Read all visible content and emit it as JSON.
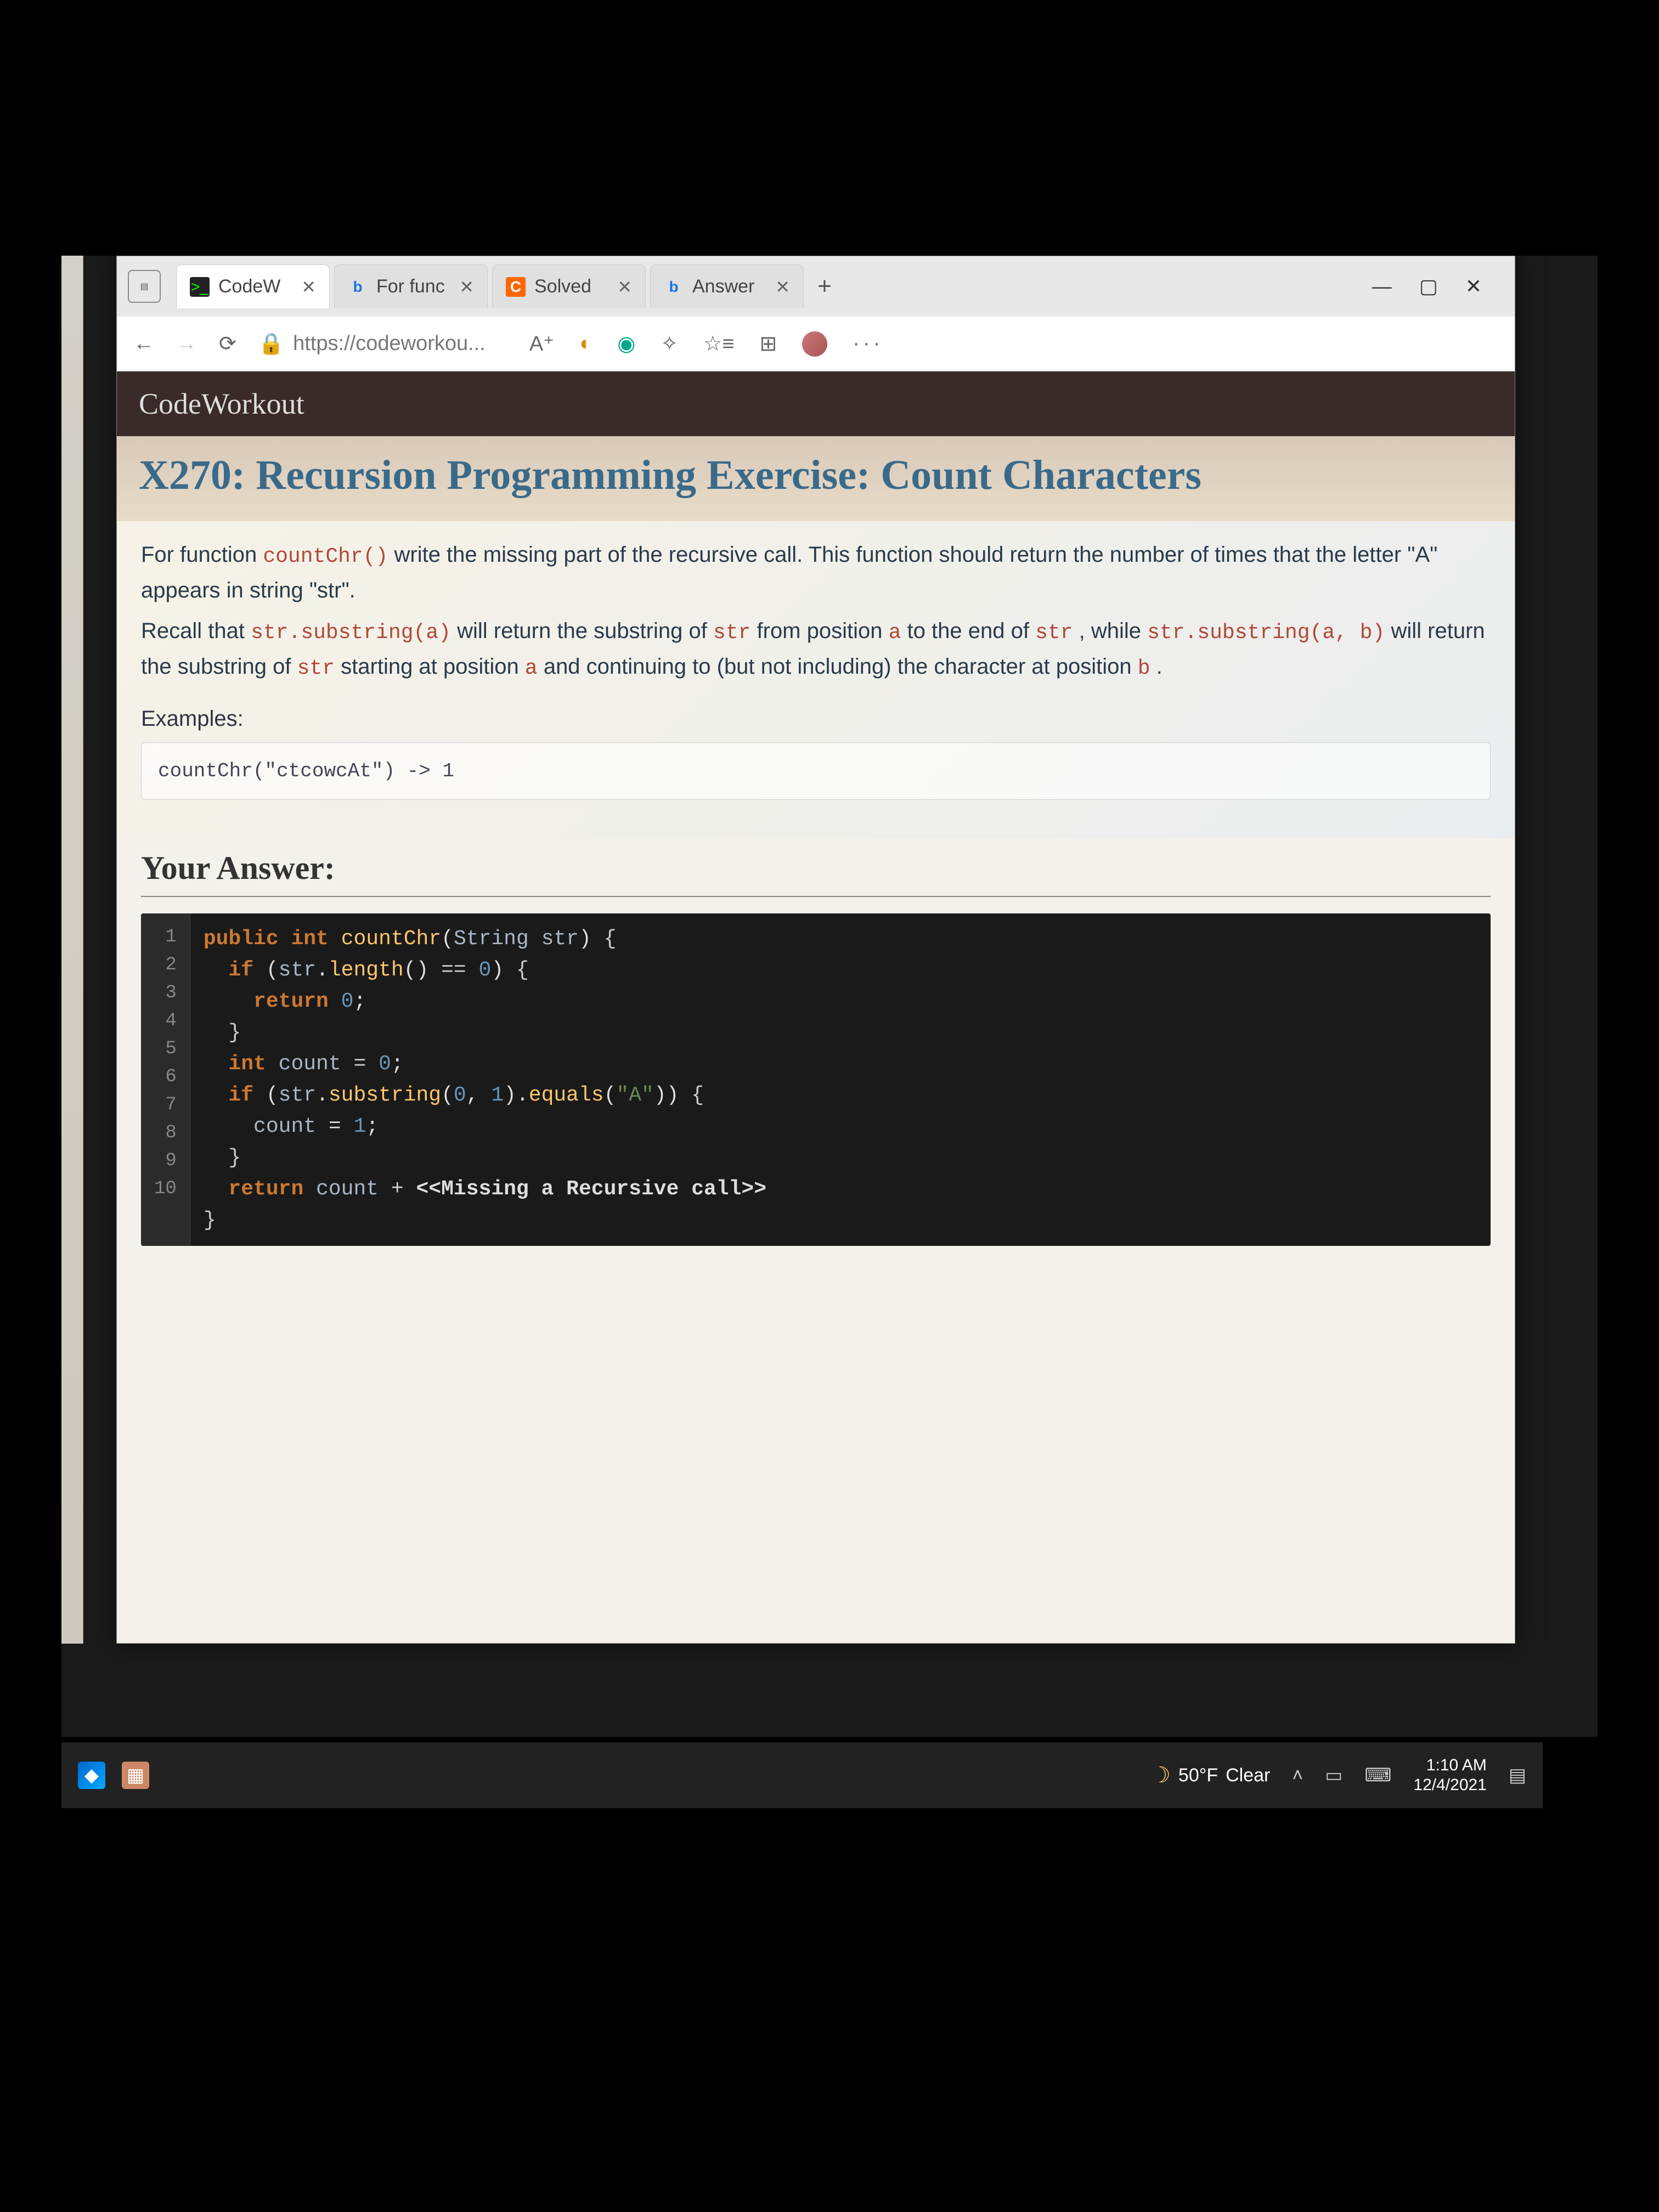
{
  "browser": {
    "tabs": [
      {
        "favicon": ">_",
        "label": "CodeW",
        "active": true
      },
      {
        "favicon": "b",
        "label": "For func",
        "active": false
      },
      {
        "favicon": "C",
        "label": "Solved",
        "active": false
      },
      {
        "favicon": "b",
        "label": "Answer",
        "active": false
      }
    ],
    "url": "https://codeworkou...",
    "window_controls": {
      "minimize": "—",
      "maximize": "▢",
      "close": "✕"
    }
  },
  "page": {
    "site_name": "CodeWorkout",
    "title": "X270: Recursion Programming Exercise: Count Characters",
    "description_parts": {
      "p1a": "For function ",
      "p1_code1": "countChr()",
      "p1b": " write the missing part of the recursive call. This function should return the number of times that the letter \"A\" appears in string \"str\".",
      "p2a": "Recall that ",
      "p2_code1": "str.substring(a)",
      "p2b": " will return the substring of ",
      "p2_code2": "str",
      "p2c": " from position ",
      "p2_code3": "a",
      "p2d": " to the end of ",
      "p2_code4": "str",
      "p2e": " , while ",
      "p2_code5": "str.substring(a, b)",
      "p2f": " will return the substring of ",
      "p2_code6": "str",
      "p2g": " starting at position ",
      "p2_code7": "a",
      "p2h": " and continuing to (but not including) the character at position ",
      "p2_code8": "b",
      "p2i": " ."
    },
    "examples_label": "Examples:",
    "example": "countChr(\"ctcowcAt\") -> 1",
    "answer_heading": "Your Answer:",
    "code_lines": {
      "l1": "1",
      "l2": "2",
      "l3": "3",
      "l4": "4",
      "l5": "5",
      "l6": "6",
      "l7": "7",
      "l8": "8",
      "l9": "9",
      "l10": "10"
    },
    "code": {
      "public": "public",
      "int": "int",
      "countChr": "countChr",
      "String": "String",
      "str_param": "str",
      "ob": "{",
      "if": "if",
      "str": "str",
      "length": "length",
      "eq": " == ",
      "zero": "0",
      "cb": "}",
      "return": "return",
      "semizero": "0",
      "count_decl": "int",
      "count": "count",
      "assign_zero": " = ",
      "z2": "0",
      "substring": "substring",
      "c0": "0",
      "c1": "1",
      "equals": "equals",
      "A": "\"A\"",
      "one": "1",
      "plus": " + ",
      "missing": "<<Missing a Recursive call>>"
    }
  },
  "taskbar": {
    "weather_temp": "50°F",
    "weather_cond": "Clear",
    "time": "1:10 AM",
    "date": "12/4/2021"
  }
}
